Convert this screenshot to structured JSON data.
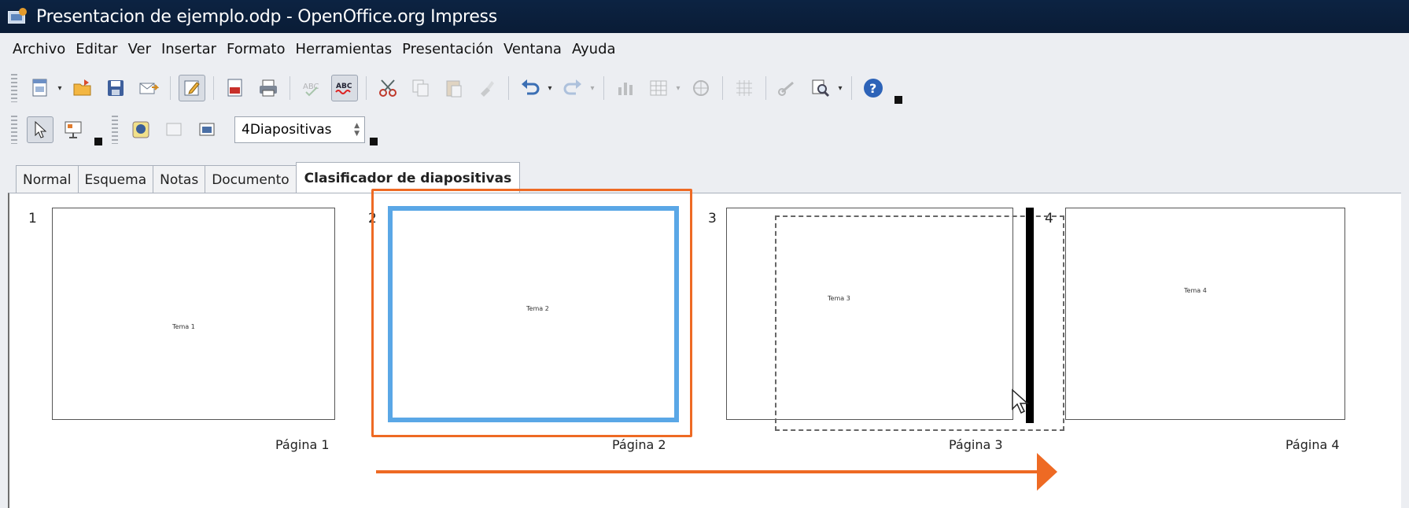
{
  "window": {
    "title": "Presentacion de ejemplo.odp - OpenOffice.org Impress"
  },
  "menu": {
    "items": [
      "Archivo",
      "Editar",
      "Ver",
      "Insertar",
      "Formato",
      "Herramientas",
      "Presentación",
      "Ventana",
      "Ayuda"
    ]
  },
  "toolbar2": {
    "slides_per_row": "4Diapositivas"
  },
  "tabs": [
    "Normal",
    "Esquema",
    "Notas",
    "Documento",
    "Clasificador de diapositivas"
  ],
  "slides": [
    {
      "number": "1",
      "text": "Tema 1",
      "page": "Página 1"
    },
    {
      "number": "2",
      "text": "Tema 2",
      "page": "Página 2"
    },
    {
      "number": "3",
      "text": "Tema 3",
      "page": "Página 3"
    },
    {
      "number": "4",
      "text": "Tema 4",
      "page": "Página 4"
    }
  ],
  "colors": {
    "annotation": "#ee6a24",
    "selection": "#5aa7e6",
    "titlebar": "#0c2342"
  }
}
